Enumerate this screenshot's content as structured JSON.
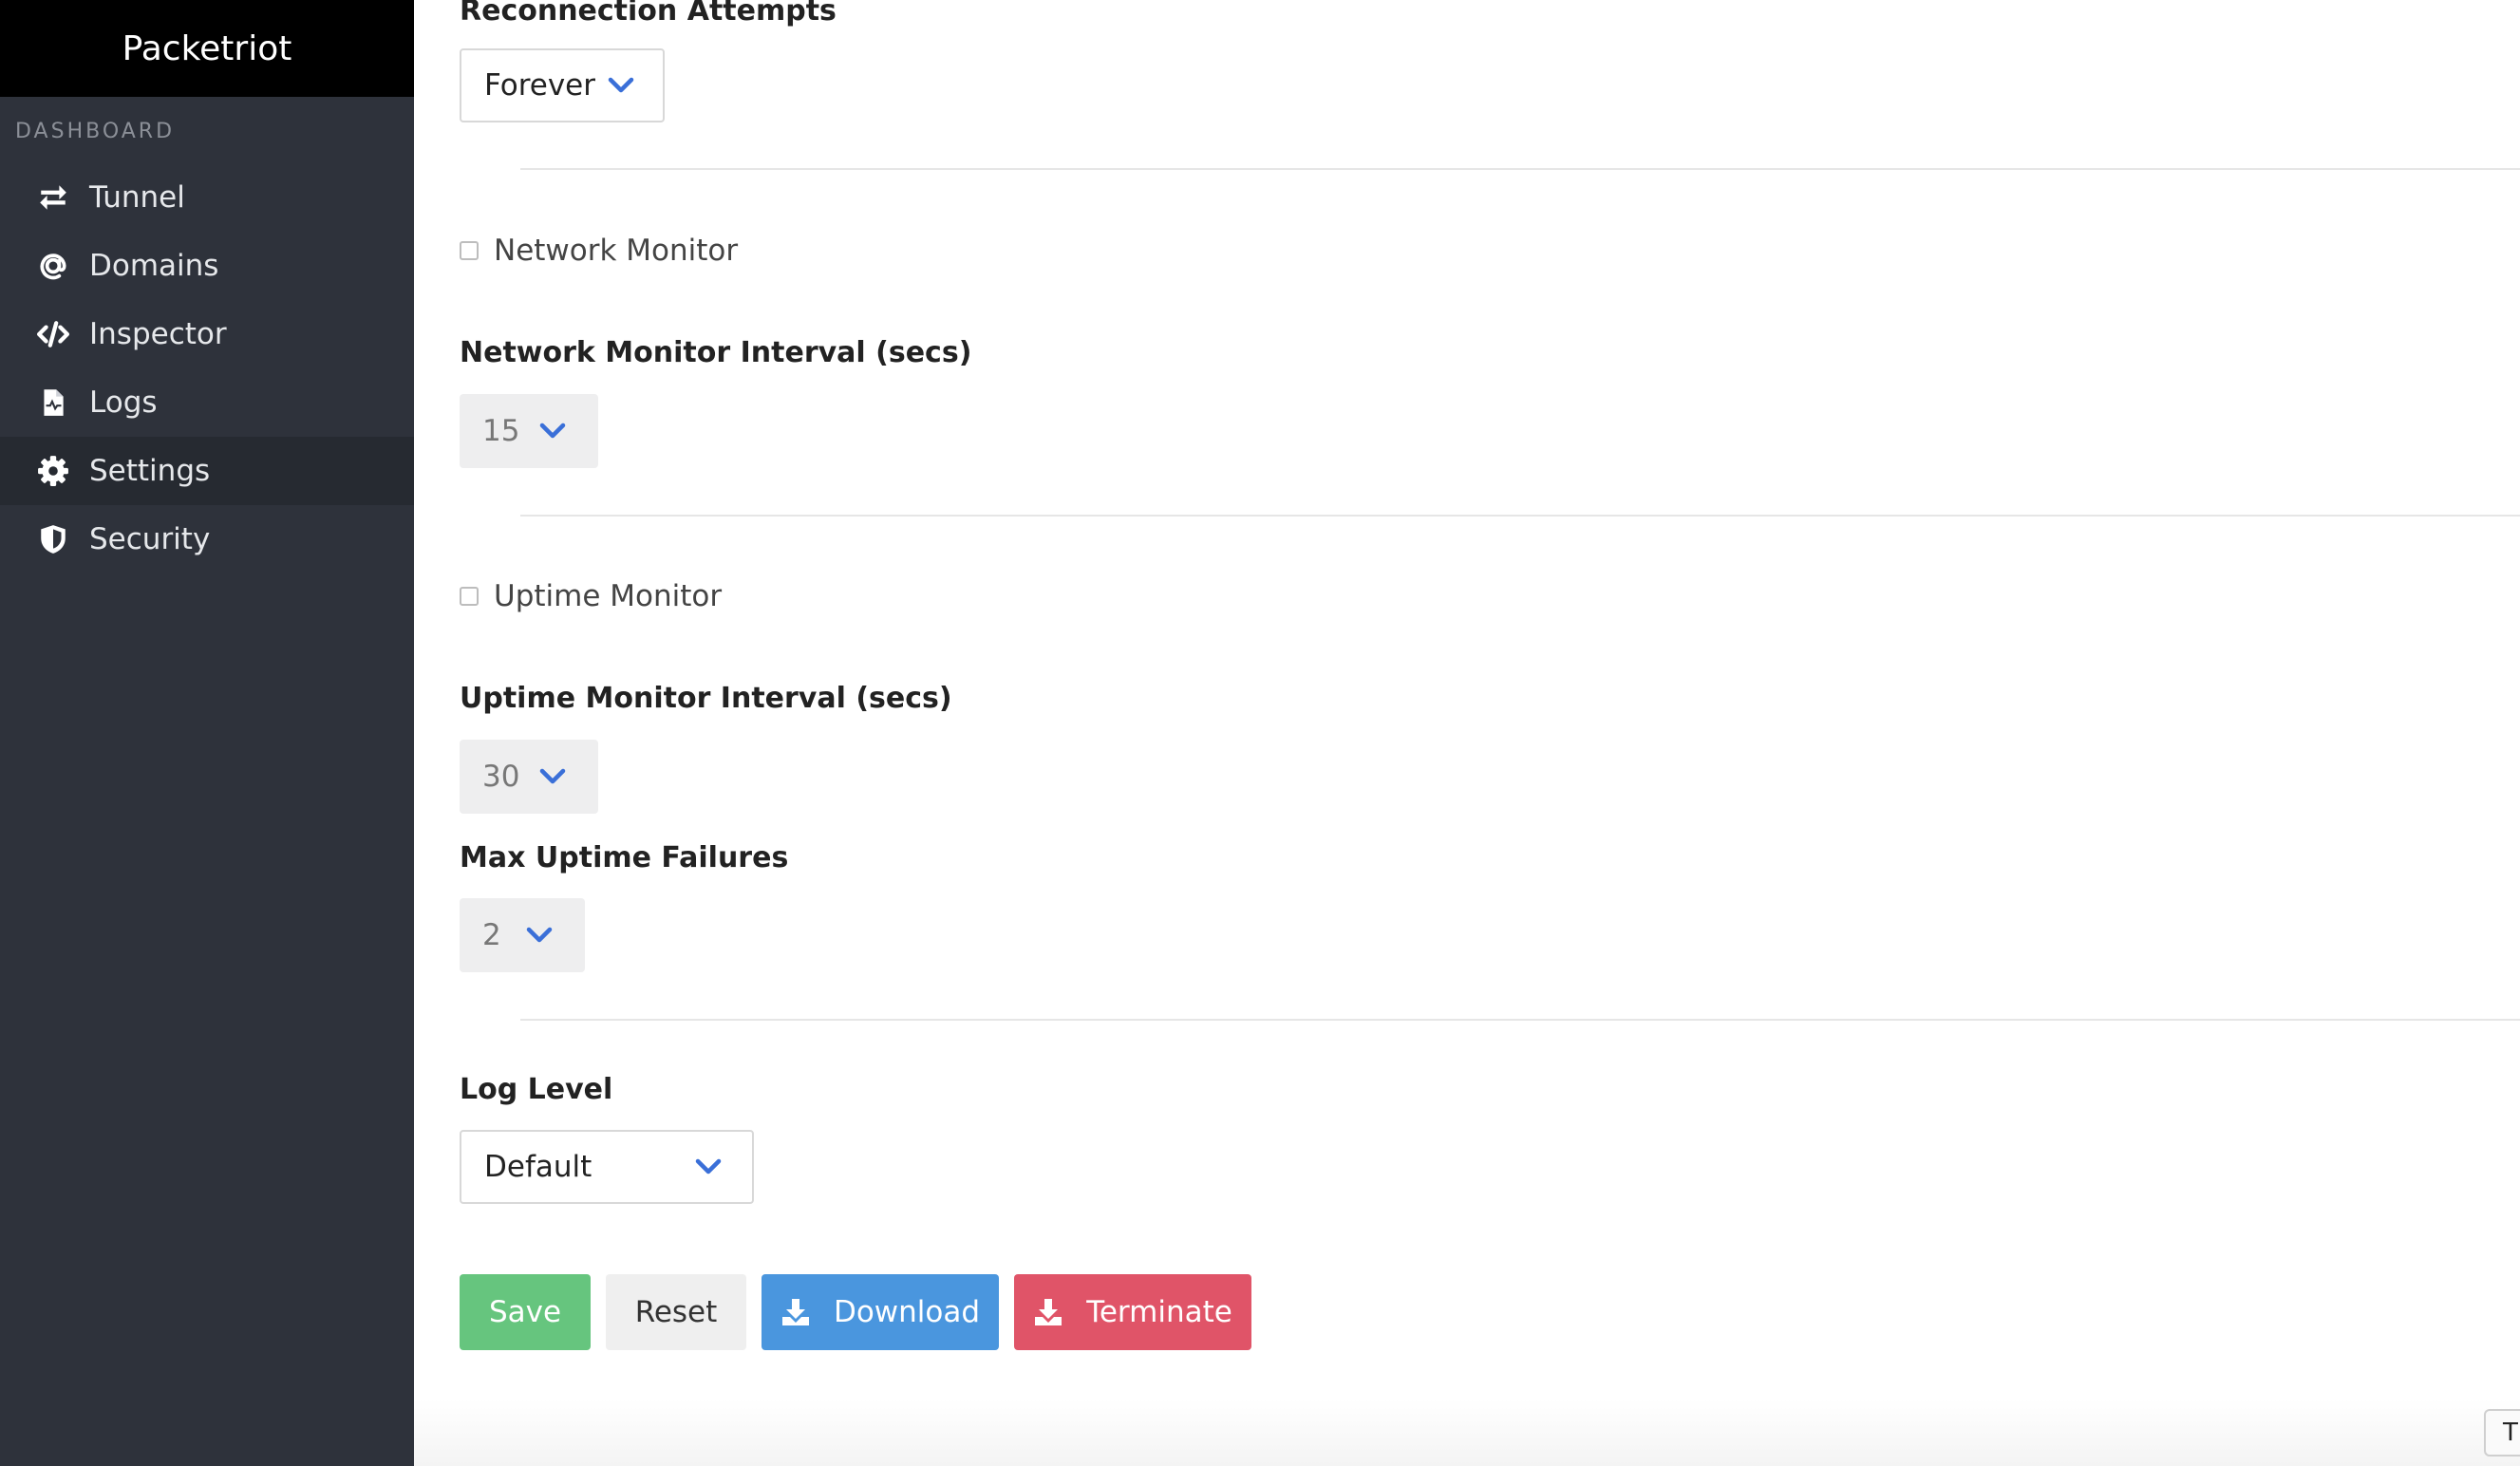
{
  "app": {
    "brand": "Packetriot"
  },
  "sidebar": {
    "section_label": "DASHBOARD",
    "items": [
      {
        "label": "Tunnel",
        "icon": "exchange-icon"
      },
      {
        "label": "Domains",
        "icon": "at-icon"
      },
      {
        "label": "Inspector",
        "icon": "code-icon"
      },
      {
        "label": "Logs",
        "icon": "file-pulse-icon"
      },
      {
        "label": "Settings",
        "icon": "gear-icon",
        "active": true
      },
      {
        "label": "Security",
        "icon": "shield-icon"
      }
    ]
  },
  "settings": {
    "reconnection_attempts": {
      "label": "Reconnection Attempts",
      "value": "Forever"
    },
    "network_monitor": {
      "label": "Network Monitor",
      "checked": false
    },
    "network_monitor_interval": {
      "label": "Network Monitor Interval (secs)",
      "value": "15"
    },
    "uptime_monitor": {
      "label": "Uptime Monitor",
      "checked": false
    },
    "uptime_monitor_interval": {
      "label": "Uptime Monitor Interval (secs)",
      "value": "30"
    },
    "max_uptime_failures": {
      "label": "Max Uptime Failures",
      "value": "2"
    },
    "log_level": {
      "label": "Log Level",
      "value": "Default"
    }
  },
  "actions": {
    "save": "Save",
    "reset": "Reset",
    "download": "Download",
    "terminate": "Terminate"
  },
  "corner_tab": {
    "label": "T"
  },
  "colors": {
    "sidebar_bg": "#2e323b",
    "brand_bg": "#000000",
    "accent_blue": "#3a6fd8",
    "save_green": "#66c57e",
    "download_blue": "#4a96de",
    "terminate_red": "#e05468"
  }
}
